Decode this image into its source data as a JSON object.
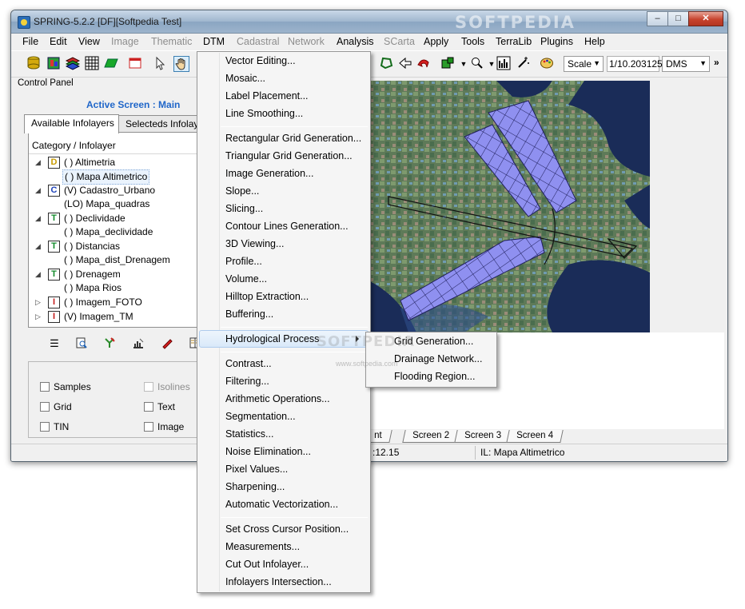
{
  "window": {
    "title": "SPRING-5.2.2 [DF][Softpedia Test]",
    "watermark": "SOFTPEDIA",
    "minimize_glyph": "–",
    "maximize_glyph": "□",
    "close_glyph": "✕"
  },
  "menubar": [
    {
      "label": "File",
      "enabled": true
    },
    {
      "label": "Edit",
      "enabled": true
    },
    {
      "label": "View",
      "enabled": true
    },
    {
      "label": "Image",
      "enabled": false
    },
    {
      "label": "Thematic",
      "enabled": false
    },
    {
      "label": "DTM",
      "enabled": true
    },
    {
      "label": "Cadastral",
      "enabled": false
    },
    {
      "label": "Network",
      "enabled": false
    },
    {
      "label": "Analysis",
      "enabled": true
    },
    {
      "label": "SCarta",
      "enabled": false
    },
    {
      "label": "Apply",
      "enabled": true
    },
    {
      "label": "Tools",
      "enabled": true
    },
    {
      "label": "TerraLib",
      "enabled": true
    },
    {
      "label": "Plugins",
      "enabled": true
    },
    {
      "label": "Help",
      "enabled": true
    }
  ],
  "toolbar": {
    "scale_label": "Scale",
    "scale_value": "1/10.203125",
    "coord_format": "DMS",
    "overflow": "»"
  },
  "control_panel": {
    "title": "Control Panel",
    "active_screen": "Active Screen : Main",
    "tabs": [
      "Available Infolayers",
      "Selecteds Infolayers"
    ],
    "tree_header": "Category / Infolayer",
    "tree": [
      {
        "type": "category",
        "expander": "◢",
        "badge": "D",
        "badge_color": "#c89b00",
        "label": "( ) Altimetria"
      },
      {
        "type": "layer",
        "label": "( ) Mapa Altimetrico",
        "selected": true
      },
      {
        "type": "category",
        "expander": "◢",
        "badge": "C",
        "badge_color": "#1a3fb8",
        "label": "(V) Cadastro_Urbano"
      },
      {
        "type": "layer",
        "label": "(LO) Mapa_quadras"
      },
      {
        "type": "category",
        "expander": "◢",
        "badge": "T",
        "badge_color": "#128a2a",
        "label": "( ) Declividade"
      },
      {
        "type": "layer",
        "label": "( ) Mapa_declividade"
      },
      {
        "type": "category",
        "expander": "◢",
        "badge": "T",
        "badge_color": "#128a2a",
        "label": "( ) Distancias"
      },
      {
        "type": "layer",
        "label": "( ) Mapa_dist_Drenagem"
      },
      {
        "type": "category",
        "expander": "◢",
        "badge": "T",
        "badge_color": "#128a2a",
        "label": "( ) Drenagem"
      },
      {
        "type": "layer",
        "label": "( ) Mapa Rios"
      },
      {
        "type": "category",
        "expander": "▷",
        "badge": "I",
        "badge_color": "#c41a1a",
        "label": "( ) Imagem_FOTO"
      },
      {
        "type": "category",
        "expander": "▷",
        "badge": "I",
        "badge_color": "#c41a1a",
        "label": "(V) Imagem_TM"
      }
    ],
    "options": [
      {
        "label": "Samples",
        "enabled": true
      },
      {
        "label": "Isolines",
        "enabled": false
      },
      {
        "label": "Grid",
        "enabled": true
      },
      {
        "label": "Text",
        "enabled": true
      },
      {
        "label": "TIN",
        "enabled": true
      },
      {
        "label": "Image",
        "enabled": true
      }
    ]
  },
  "dtm_menu": {
    "items": [
      "Vector Editing...",
      "Mosaic...",
      "Label Placement...",
      "Line Smoothing...",
      "Rectangular Grid Generation...",
      "Triangular Grid Generation...",
      "Image Generation...",
      "Slope...",
      "Slicing...",
      "Contour Lines Generation...",
      "3D Viewing...",
      "Profile...",
      "Volume...",
      "Hilltop Extraction...",
      "Buffering...",
      "Hydrological Process",
      "Contrast...",
      "Filtering...",
      "Arithmetic Operations...",
      "Segmentation...",
      "Statistics...",
      "Noise Elimination...",
      "Pixel Values...",
      "Sharpening...",
      "Automatic Vectorization...",
      "Set Cross Cursor Position...",
      "Measurements...",
      "Cut Out Infolayer...",
      "Infolayers Intersection..."
    ],
    "hover_item": "Hydrological Process"
  },
  "hydrological_submenu": {
    "items": [
      "Grid Generation...",
      "Drainage Network...",
      "Flooding Region..."
    ]
  },
  "screen_tabs": [
    "nt",
    "Screen 2",
    "Screen 3",
    "Screen 4"
  ],
  "status": {
    "coordinate_fragment": ":12.15",
    "infolayer": "IL: Mapa Altimetrico"
  },
  "overlay_watermark": {
    "text": "SOFTPEDIA",
    "url": "www.softpedia.com"
  },
  "colors": {
    "accent_blue": "#1f66c9",
    "map_overlay": "#8f90f0",
    "menu_hover": "#d9e9f9"
  },
  "icons": {
    "toolbar_left": [
      "database-icon",
      "image-stack-icon",
      "layers-icon",
      "grid-icon",
      "parallelogram-icon",
      "window-icon",
      "cursor-icon",
      "pan-hand-icon"
    ],
    "toolbar_right": [
      "polygon-select-icon",
      "arrow-left-icon",
      "undo-icon",
      "color-box-icon",
      "zoom-in-icon",
      "histogram-icon",
      "sparkle-icon",
      "palette-icon"
    ],
    "panel_tools": [
      "list-icon",
      "zoom-doc-icon",
      "tree-edit-icon",
      "chart-edit-icon",
      "pen-icon",
      "book-icon"
    ]
  }
}
